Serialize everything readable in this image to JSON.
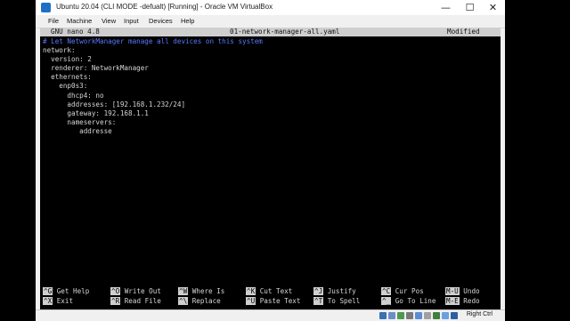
{
  "window": {
    "title": "Ubuntu 20.04 (CLI MODE -defualt) [Running] - Oracle VM VirtualBox",
    "controls": [
      "—",
      "☐",
      "✕"
    ]
  },
  "menu": [
    "File",
    "Machine",
    "View",
    "Input",
    "Devices",
    "Help"
  ],
  "nano": {
    "version": "GNU nano 4.8",
    "filename": "01-network-manager-all.yaml",
    "state": "Modified"
  },
  "file_lines": [
    "# Let NetworkManager manage all devices on this system",
    "network:",
    "  version: 2",
    "  renderer: NetworkManager",
    "  ethernets:",
    "    enp0s3:",
    "      dhcp4: no",
    "      addresses: [192.168.1.232/24]",
    "      gateway: 192.168.1.1",
    "      nameservers:",
    "         addresse"
  ],
  "shortcuts": [
    {
      "key": "^G",
      "label": "Get Help"
    },
    {
      "key": "^X",
      "label": "Exit"
    },
    {
      "key": "^O",
      "label": "Write Out"
    },
    {
      "key": "^R",
      "label": "Read File"
    },
    {
      "key": "^W",
      "label": "Where Is"
    },
    {
      "key": "^\\",
      "label": "Replace"
    },
    {
      "key": "^K",
      "label": "Cut Text"
    },
    {
      "key": "^U",
      "label": "Paste Text"
    },
    {
      "key": "^J",
      "label": "Justify"
    },
    {
      "key": "^T",
      "label": "To Spell"
    },
    {
      "key": "^C",
      "label": "Cur Pos"
    },
    {
      "key": "^_",
      "label": "Go To Line"
    },
    {
      "key": "M-U",
      "label": "Undo"
    },
    {
      "key": "M-E",
      "label": "Redo"
    }
  ],
  "status": {
    "host_key": "Right Ctrl",
    "icon_colors": [
      "#3b6fb6",
      "#6a8fc8",
      "#4c9a4c",
      "#7a7a7a",
      "#5b8dd6",
      "#a0a0a0",
      "#3f7f3f",
      "#6aa0e0",
      "#2f5fa0"
    ]
  }
}
